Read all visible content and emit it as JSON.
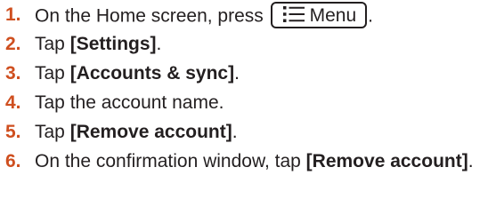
{
  "steps": [
    {
      "number": "1.",
      "text_before": "On the Home screen, press ",
      "button": {
        "icon": "menu-list-icon",
        "label": "Menu"
      },
      "text_after": "."
    },
    {
      "number": "2.",
      "text": "Tap ",
      "bold": "[Settings]",
      "text_after": "."
    },
    {
      "number": "3.",
      "text": "Tap ",
      "bold": "[Accounts & sync]",
      "text_after": "."
    },
    {
      "number": "4.",
      "text": "Tap the account name."
    },
    {
      "number": "5.",
      "text": "Tap ",
      "bold": "[Remove account]",
      "text_after": "."
    },
    {
      "number": "6.",
      "text": "On the confirmation window, tap ",
      "bold": "[Remove account]",
      "text_after": "."
    }
  ],
  "colors": {
    "step_number": "#cf4f1f",
    "text": "#231f20"
  }
}
